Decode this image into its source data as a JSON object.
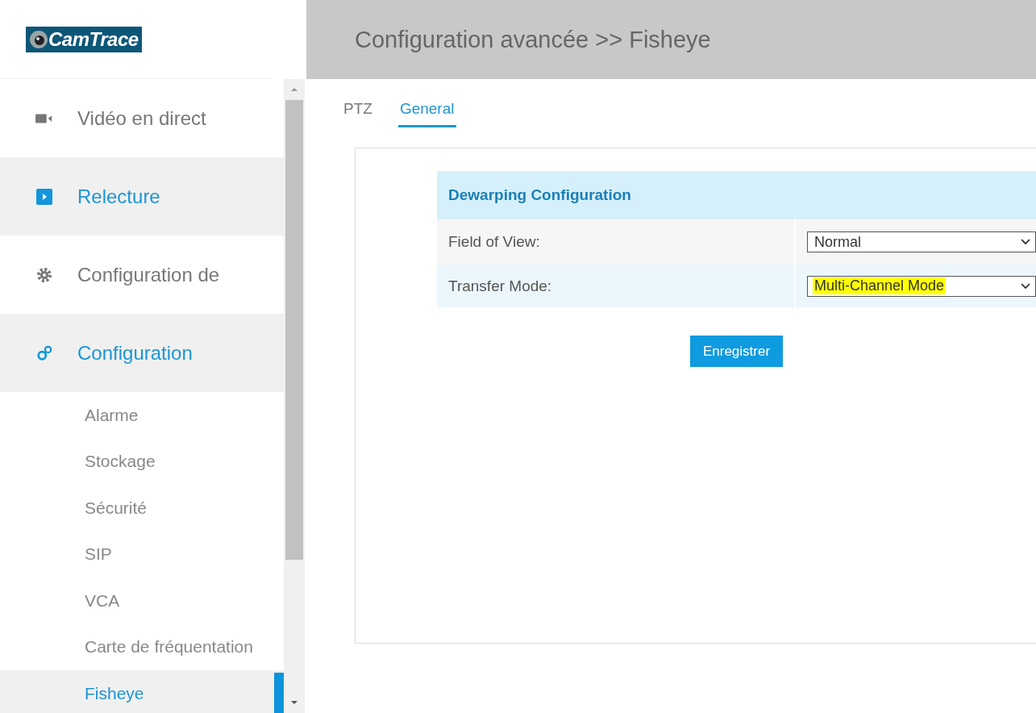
{
  "logo": {
    "text": "CamTrace"
  },
  "header": {
    "title": "Configuration avancée >> Fisheye"
  },
  "sidebar": {
    "items": [
      {
        "label": "Vidéo en direct",
        "kind": "top",
        "active": false
      },
      {
        "label": "Relecture",
        "kind": "top",
        "active": true
      },
      {
        "label": "Configuration de",
        "kind": "top",
        "active": false
      },
      {
        "label": "Configuration",
        "kind": "top",
        "active": true
      },
      {
        "label": "Alarme",
        "kind": "sub",
        "active": false,
        "selected": false
      },
      {
        "label": "Stockage",
        "kind": "sub",
        "active": false,
        "selected": false
      },
      {
        "label": "Sécurité",
        "kind": "sub",
        "active": false,
        "selected": false
      },
      {
        "label": "SIP",
        "kind": "sub",
        "active": false,
        "selected": false
      },
      {
        "label": "VCA",
        "kind": "sub",
        "active": false,
        "selected": false
      },
      {
        "label": "Carte de fréquentation",
        "kind": "sub",
        "active": false,
        "selected": false
      },
      {
        "label": "Fisheye",
        "kind": "sub",
        "active": true,
        "selected": true
      }
    ]
  },
  "tabs": [
    {
      "label": "PTZ",
      "selected": false
    },
    {
      "label": "General",
      "selected": true
    }
  ],
  "section": {
    "title": "Dewarping Configuration",
    "rows": [
      {
        "label": "Field of View:",
        "value": "Normal",
        "highlighted": false
      },
      {
        "label": "Transfer Mode:",
        "value": "Multi-Channel Mode",
        "highlighted": true
      }
    ]
  },
  "save_button": "Enregistrer"
}
